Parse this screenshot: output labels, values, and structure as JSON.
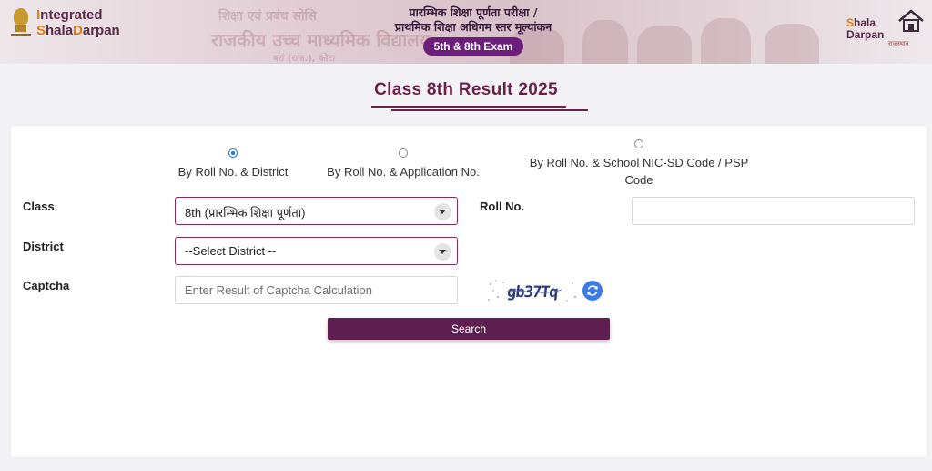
{
  "header": {
    "brand_line1_cap": "I",
    "brand_line1_rest": "ntegrated",
    "brand_line2_s": "S",
    "brand_line2_hala": "hala",
    "brand_line2_d": "D",
    "brand_line2_arpan": "arpan",
    "title_line1": "प्रारम्भिक शिक्षा पूर्णता परीक्षा /",
    "title_line2": "प्राथमिक शिक्षा अधिगम स्तर मूल्यांकन",
    "exam_pill": "5th & 8th Exam",
    "right_logo_line1_s": "S",
    "right_logo_line1_rest": "hala",
    "right_logo_line2": "Darpan",
    "right_logo_sub": "राजस्थान",
    "background_text_1": "शिक्षा एवं प्रबंध सोसि",
    "background_text_2": "राजकीय उच्च माध्यमिक विद्यालय",
    "background_text_3": "बरां (राज.), कोटा"
  },
  "page": {
    "heading": "Class 8th Result 2025"
  },
  "search_options": [
    {
      "label": "By Roll No. & District",
      "checked": true
    },
    {
      "label": "By Roll No. & Application No.",
      "checked": false
    },
    {
      "label": "By Roll No. & School NIC-SD Code / PSP Code",
      "checked": false
    }
  ],
  "form": {
    "class_label": "Class",
    "class_value": "8th (प्रारम्भिक शिक्षा पूर्णता)",
    "roll_label": "Roll No.",
    "roll_value": "",
    "district_label": "District",
    "district_value": "--Select District --",
    "captcha_label": "Captcha",
    "captcha_placeholder": "Enter Result of Captcha Calculation",
    "captcha_text": "gb37Tq",
    "search_button": "Search"
  },
  "colors": {
    "brand_purple": "#5e1f50",
    "accent_orange": "#e07b10",
    "pill_purple": "#6b1f7a",
    "radio_blue": "#1a73e8",
    "refresh_blue": "#3a7be8"
  },
  "icons": {
    "emblem": "national-emblem-icon",
    "house": "house-icon",
    "refresh": "refresh-icon",
    "dropdown": "chevron-down-icon"
  }
}
